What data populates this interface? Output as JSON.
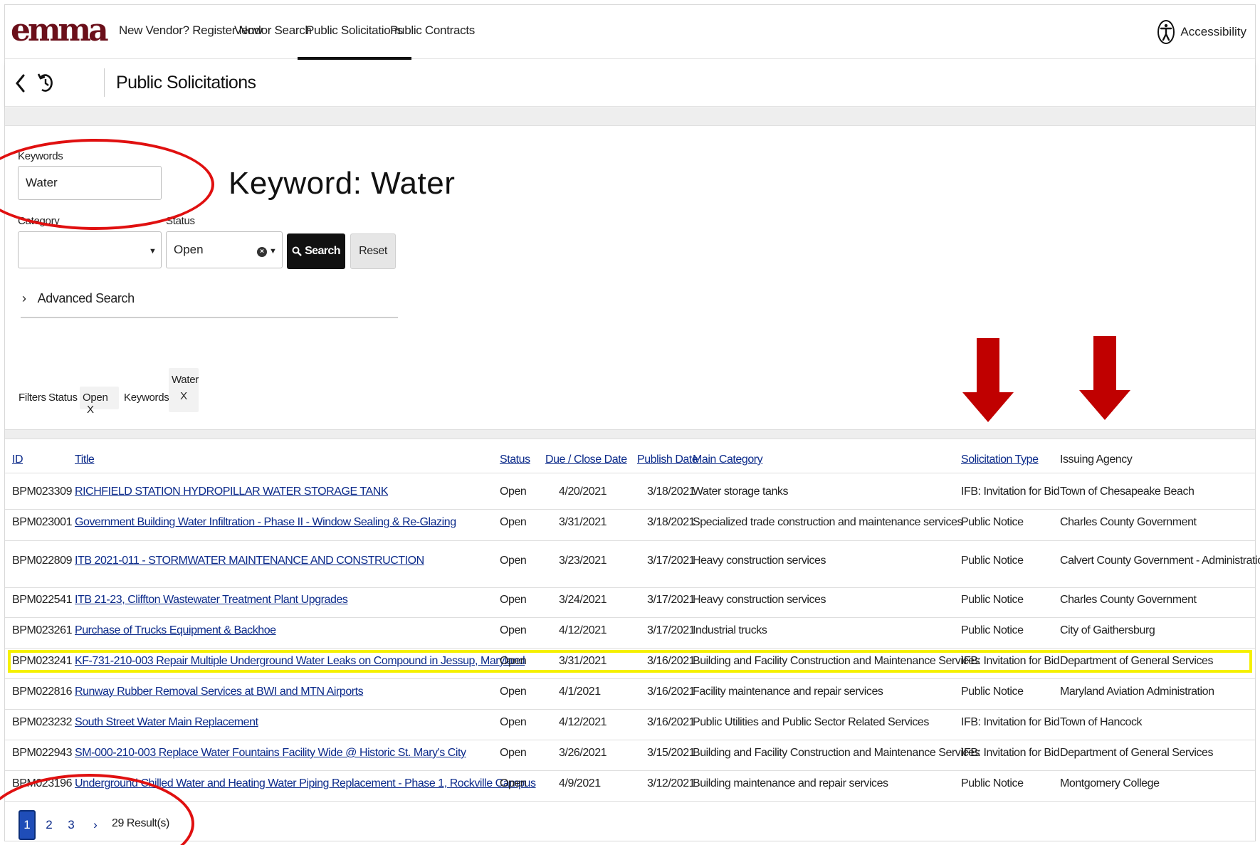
{
  "nav": {
    "logo_text": "emma",
    "items": [
      "New Vendor? Register Now",
      "Vendor Search",
      "Public Solicitations",
      "Public Contracts"
    ],
    "active_index": 2,
    "accessibility_label": "Accessibility"
  },
  "subheader": {
    "title": "Public Solicitations"
  },
  "search": {
    "keywords_label": "Keywords",
    "keywords_value": "Water",
    "category_label": "Category",
    "category_value": "",
    "status_label": "Status",
    "status_value": "Open",
    "search_label": "Search",
    "reset_label": "Reset",
    "advanced_label": "Advanced Search"
  },
  "annotation": {
    "keyword_text": "Keyword: Water"
  },
  "filters": {
    "label": "Filters",
    "status_key": "Status :",
    "status_value": "Open",
    "keywords_key": "Keywords :",
    "keywords_value": "Water",
    "remove_symbol": "X"
  },
  "table": {
    "headers": [
      "ID",
      "Title",
      "Status",
      "Due / Close Date",
      "Publish Date",
      "Main Category",
      "Solicitation Type",
      "Issuing Agency"
    ],
    "rows": [
      [
        "BPM023309",
        "RICHFIELD STATION HYDROPILLAR WATER STORAGE TANK",
        "Open",
        "4/20/2021",
        "3/18/2021",
        "Water storage tanks",
        "IFB: Invitation for Bid",
        "Town of Chesapeake Beach"
      ],
      [
        "BPM023001",
        "Government Building Water Infiltration - Phase II - Window Sealing & Re-Glazing",
        "Open",
        "3/31/2021",
        "3/18/2021",
        "Specialized trade construction and maintenance services",
        "Public Notice",
        "Charles County Government"
      ],
      [
        "BPM022809",
        "ITB 2021-011 - STORMWATER MAINTENANCE AND CONSTRUCTION",
        "Open",
        "3/23/2021",
        "3/17/2021",
        "Heavy construction services",
        "Public Notice",
        "Calvert County Government - Administration"
      ],
      [
        "BPM022541",
        "ITB 21-23, Cliffton Wastewater Treatment Plant Upgrades",
        "Open",
        "3/24/2021",
        "3/17/2021",
        "Heavy construction services",
        "Public Notice",
        "Charles County Government"
      ],
      [
        "BPM023261",
        "Purchase of Trucks Equipment & Backhoe",
        "Open",
        "4/12/2021",
        "3/17/2021",
        "Industrial trucks",
        "Public Notice",
        "City of Gaithersburg"
      ],
      [
        "BPM023241",
        "KF-731-210-003 Repair Multiple Underground Water Leaks on Compound in Jessup, Maryland",
        "Open",
        "3/31/2021",
        "3/16/2021",
        "Building and Facility Construction and Maintenance Services",
        "IFB: Invitation for Bid",
        "Department of General Services"
      ],
      [
        "BPM022816",
        "Runway Rubber Removal Services at BWI and MTN Airports",
        "Open",
        "4/1/2021",
        "3/16/2021",
        "Facility maintenance and repair services",
        "Public Notice",
        "Maryland Aviation Administration"
      ],
      [
        "BPM023232",
        "South Street Water Main Replacement",
        "Open",
        "4/12/2021",
        "3/16/2021",
        "Public Utilities and Public Sector Related Services",
        "IFB: Invitation for Bid",
        "Town of Hancock"
      ],
      [
        "BPM022943",
        "SM-000-210-003 Replace Water Fountains Facility Wide @ Historic St. Mary's City",
        "Open",
        "3/26/2021",
        "3/15/2021",
        "Building and Facility Construction and Maintenance Services",
        "IFB: Invitation for Bid",
        "Department of General Services"
      ],
      [
        "BPM023196",
        "Underground Chilled Water and Heating Water Piping Replacement - Phase 1, Rockville Campus",
        "Open",
        "4/9/2021",
        "3/12/2021",
        "Building maintenance and repair services",
        "Public Notice",
        "Montgomery College"
      ]
    ],
    "highlighted_row": 5
  },
  "pagination": {
    "pages": [
      "1",
      "2",
      "3"
    ],
    "active": "1",
    "next_symbol": "›",
    "results_text": "29 Result(s)"
  },
  "colors": {
    "link": "#0b2a8a",
    "annotation_red": "#e01010",
    "annotation_arrow": "#c00000",
    "highlight_yellow": "#f5f000",
    "logo": "#6b0f1a",
    "active_page": "#1f4db8"
  }
}
